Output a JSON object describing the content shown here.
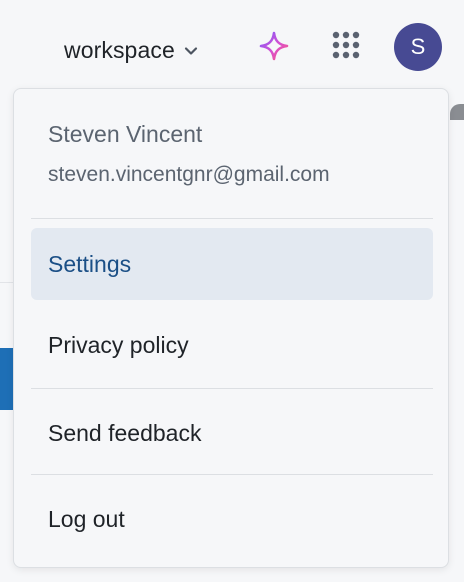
{
  "header": {
    "workspace_label": "workspace",
    "icons": {
      "chevron": "chevron-down-icon",
      "ai": "sparkle-icon",
      "apps": "apps-grid-icon"
    },
    "avatar_initial": "S",
    "avatar_color": "#474a93"
  },
  "account_menu": {
    "user_name": "Steven Vincent",
    "user_email": "steven.vincentgnr@gmail.com",
    "items": [
      {
        "label": "Settings",
        "active": true
      },
      {
        "label": "Privacy policy",
        "active": false
      },
      {
        "label": "Send feedback",
        "active": false
      },
      {
        "label": "Log out",
        "active": false
      }
    ]
  },
  "colors": {
    "accent_text": "#1b4f86",
    "active_bg": "#e3e9f1",
    "background": "#f6f7f9"
  }
}
